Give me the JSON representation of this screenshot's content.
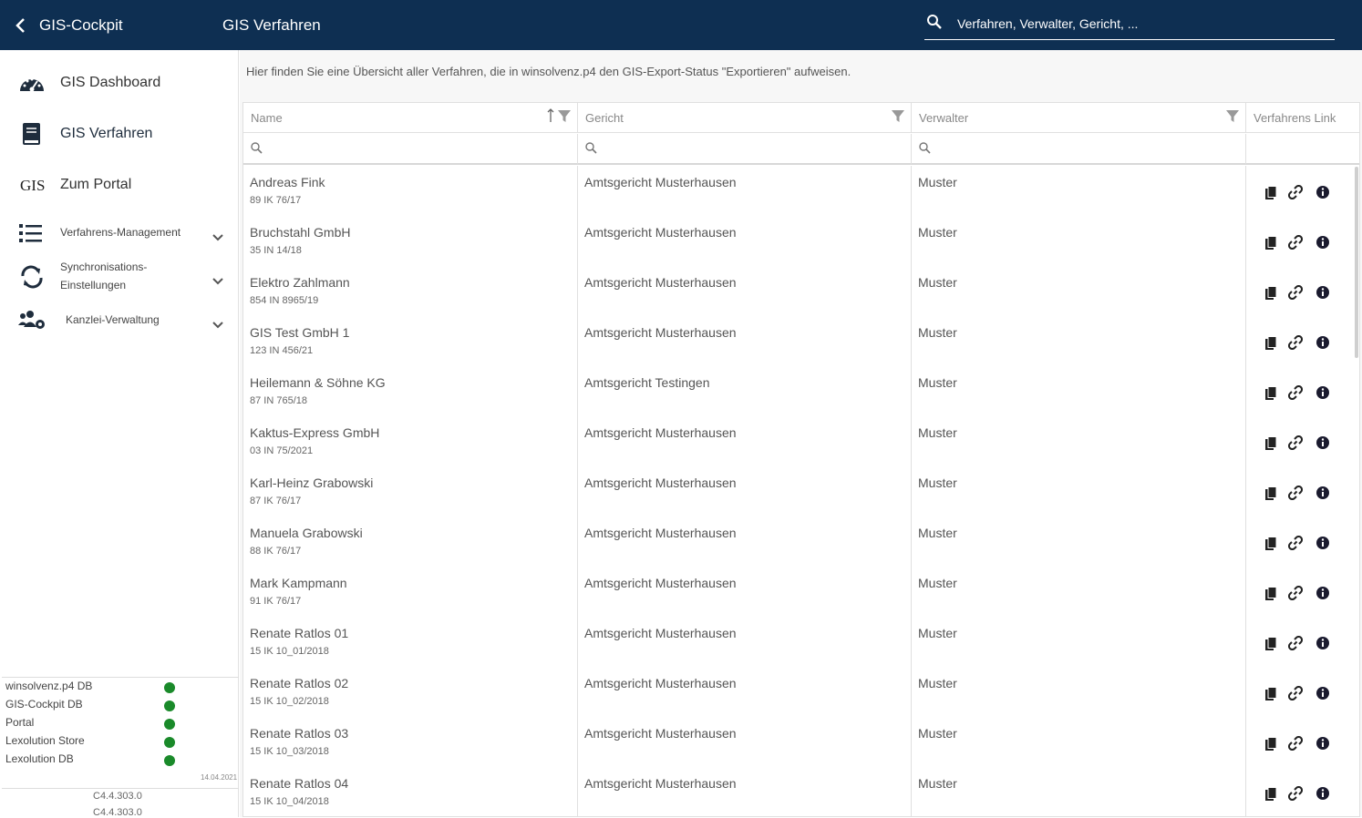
{
  "topbar": {
    "app_title": "GIS-Cockpit",
    "page_title": "GIS Verfahren",
    "search_placeholder": "Verfahren, Verwalter, Gericht, ..."
  },
  "sidebar": {
    "items": [
      {
        "label": "GIS Dashboard",
        "icon": "dashboard-gauge-icon"
      },
      {
        "label": "GIS Verfahren",
        "icon": "book-icon"
      },
      {
        "label": "Zum Portal",
        "icon": "gis-logo-icon",
        "icon_text": "GIS"
      }
    ],
    "groups": [
      {
        "label": "Verfahrens-Management",
        "icon": "list-icon"
      },
      {
        "label_line1": "Synchronisations-",
        "label_line2": "Einstellungen",
        "icon": "sync-icon"
      },
      {
        "label": "Kanzlei-Verwaltung",
        "icon": "users-cog-icon"
      }
    ],
    "status": [
      {
        "label": "winsolvenz.p4 DB",
        "color": "#1a8a2a"
      },
      {
        "label": "GIS-Cockpit DB",
        "color": "#1a8a2a"
      },
      {
        "label": "Portal",
        "color": "#1a8a2a"
      },
      {
        "label": "Lexolution Store",
        "color": "#1a8a2a"
      },
      {
        "label": "Lexolution DB",
        "color": "#1a8a2a"
      }
    ],
    "status_date": "14.04.2021",
    "versions": [
      "C4.4.303.0",
      "C4.4.303.0"
    ]
  },
  "main": {
    "info_text": "Hier finden Sie eine Übersicht aller Verfahren, die in winsolvenz.p4 den GIS-Export-Status \"Exportieren\" aufweisen.",
    "columns": [
      "Name",
      "Gericht",
      "Verwalter",
      "Verfahrens Link"
    ],
    "rows": [
      {
        "name": "Andreas Fink",
        "az": "89 IK 76/17",
        "gericht": "Amtsgericht Musterhausen",
        "verwalter": "Muster"
      },
      {
        "name": "Bruchstahl GmbH",
        "az": "35 IN 14/18",
        "gericht": "Amtsgericht Musterhausen",
        "verwalter": "Muster"
      },
      {
        "name": "Elektro Zahlmann",
        "az": "854 IN 8965/19",
        "gericht": "Amtsgericht Musterhausen",
        "verwalter": "Muster"
      },
      {
        "name": "GIS Test GmbH 1",
        "az": "123 IN 456/21",
        "gericht": "Amtsgericht Musterhausen",
        "verwalter": "Muster"
      },
      {
        "name": "Heilemann & Söhne KG",
        "az": "87 IN 765/18",
        "gericht": "Amtsgericht Testingen",
        "verwalter": "Muster"
      },
      {
        "name": "Kaktus-Express GmbH",
        "az": "03 IN 75/2021",
        "gericht": "Amtsgericht Musterhausen",
        "verwalter": "Muster"
      },
      {
        "name": "Karl-Heinz Grabowski",
        "az": "87 IK 76/17",
        "gericht": "Amtsgericht Musterhausen",
        "verwalter": "Muster"
      },
      {
        "name": "Manuela Grabowski",
        "az": "88 IK 76/17",
        "gericht": "Amtsgericht Musterhausen",
        "verwalter": "Muster"
      },
      {
        "name": "Mark Kampmann",
        "az": "91 IK 76/17",
        "gericht": "Amtsgericht Musterhausen",
        "verwalter": "Muster"
      },
      {
        "name": "Renate Ratlos 01",
        "az": "15 IK 10_01/2018",
        "gericht": "Amtsgericht Musterhausen",
        "verwalter": "Muster"
      },
      {
        "name": "Renate Ratlos 02",
        "az": "15 IK 10_02/2018",
        "gericht": "Amtsgericht Musterhausen",
        "verwalter": "Muster"
      },
      {
        "name": "Renate Ratlos 03",
        "az": "15 IK 10_03/2018",
        "gericht": "Amtsgericht Musterhausen",
        "verwalter": "Muster"
      },
      {
        "name": "Renate Ratlos 04",
        "az": "15 IK 10_04/2018",
        "gericht": "Amtsgericht Musterhausen",
        "verwalter": "Muster"
      }
    ],
    "row_actions": [
      "copy-icon",
      "link-icon",
      "info-icon"
    ]
  },
  "colors": {
    "topbar": "#0e2f52",
    "status_ok": "#1a8a2a"
  }
}
